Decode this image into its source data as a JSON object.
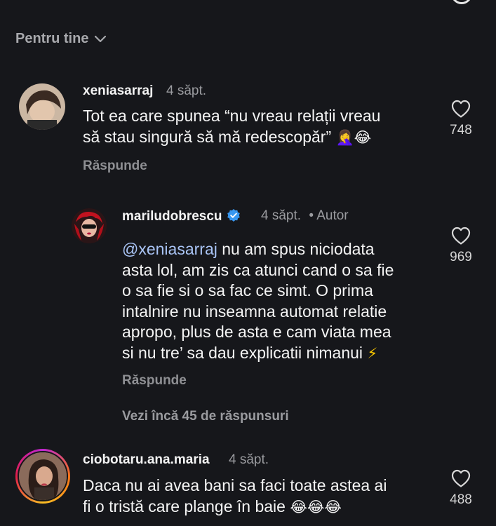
{
  "filter": {
    "label": "Pentru tine"
  },
  "comments": [
    {
      "username": "xeniasarraj",
      "time": "4 săpt.",
      "text": "Tot ea care spunea “nu vreau relații vreau\nsă stau singură să mă redescopăr”",
      "emojis": "🤦‍♀️😂",
      "reply_label": "Răspunde",
      "likes": "748",
      "avatar_colors": [
        "#c8b39e",
        "#3a2a22"
      ]
    },
    {
      "username": "mariludobrescu",
      "time": "4 săpt.",
      "author_tag": "• Autor",
      "mention": "@xeniasarraj",
      "text_rest": " nu am spus niciodata\nasta lol, am zis ca atunci cand o sa fie\no sa fie si o sa fac ce simt. O prima\nintalnire nu inseamna automat relatie\napropo, plus de asta e cam viata mea\nsi nu tre’ sa dau explicatii nimanui",
      "emojis": "⚡",
      "reply_label": "Răspunde",
      "likes": "969",
      "avatar_colors": [
        "#b5121b",
        "#1a0f10"
      ]
    },
    {
      "username": "ciobotaru.ana.maria",
      "time": "4 săpt.",
      "text": "Daca nu ai avea bani sa faci toate astea ai\nfi o tristă care plange în baie",
      "emojis": "😂😂😂",
      "likes": "488",
      "avatar_colors": [
        "#7a5a4a",
        "#2b1d18"
      ]
    }
  ],
  "view_more": "Vezi încă 45 de răspunsuri",
  "icons": {
    "filter_chevron": "chevron-down-icon",
    "like": "heart-outline-icon",
    "verified": "verified-badge-icon"
  },
  "colors": {
    "background": "#16171b",
    "mention": "#a9c4f5",
    "verified": "#3897f0"
  }
}
